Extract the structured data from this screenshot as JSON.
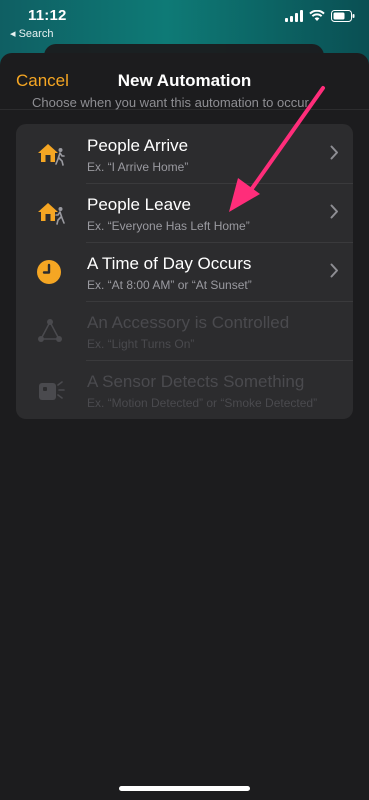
{
  "status_bar": {
    "time": "11:12",
    "back_label": "◂ Search"
  },
  "nav": {
    "cancel_label": "Cancel",
    "title": "New Automation"
  },
  "prompt": "Choose when you want this automation to occur.",
  "options": [
    {
      "title": "People Arrive",
      "subtitle": "Ex. “I Arrive Home”",
      "icon": "person-arrive-home-icon",
      "enabled": true
    },
    {
      "title": "People Leave",
      "subtitle": "Ex. “Everyone Has Left Home”",
      "icon": "person-leave-home-icon",
      "enabled": true
    },
    {
      "title": "A Time of Day Occurs",
      "subtitle": "Ex. “At 8:00 AM” or “At Sunset”",
      "icon": "clock-icon",
      "enabled": true
    },
    {
      "title": "An Accessory is Controlled",
      "subtitle": "Ex. “Light Turns On”",
      "icon": "accessory-icon",
      "enabled": false
    },
    {
      "title": "A Sensor Detects Something",
      "subtitle": "Ex. “Motion Detected” or “Smoke Detected”",
      "icon": "sensor-icon",
      "enabled": false
    }
  ],
  "colors": {
    "accent": "#f5a623",
    "arrow": "#ff2d7a",
    "sheet": "#1c1c1e",
    "row": "#2c2c2e"
  }
}
